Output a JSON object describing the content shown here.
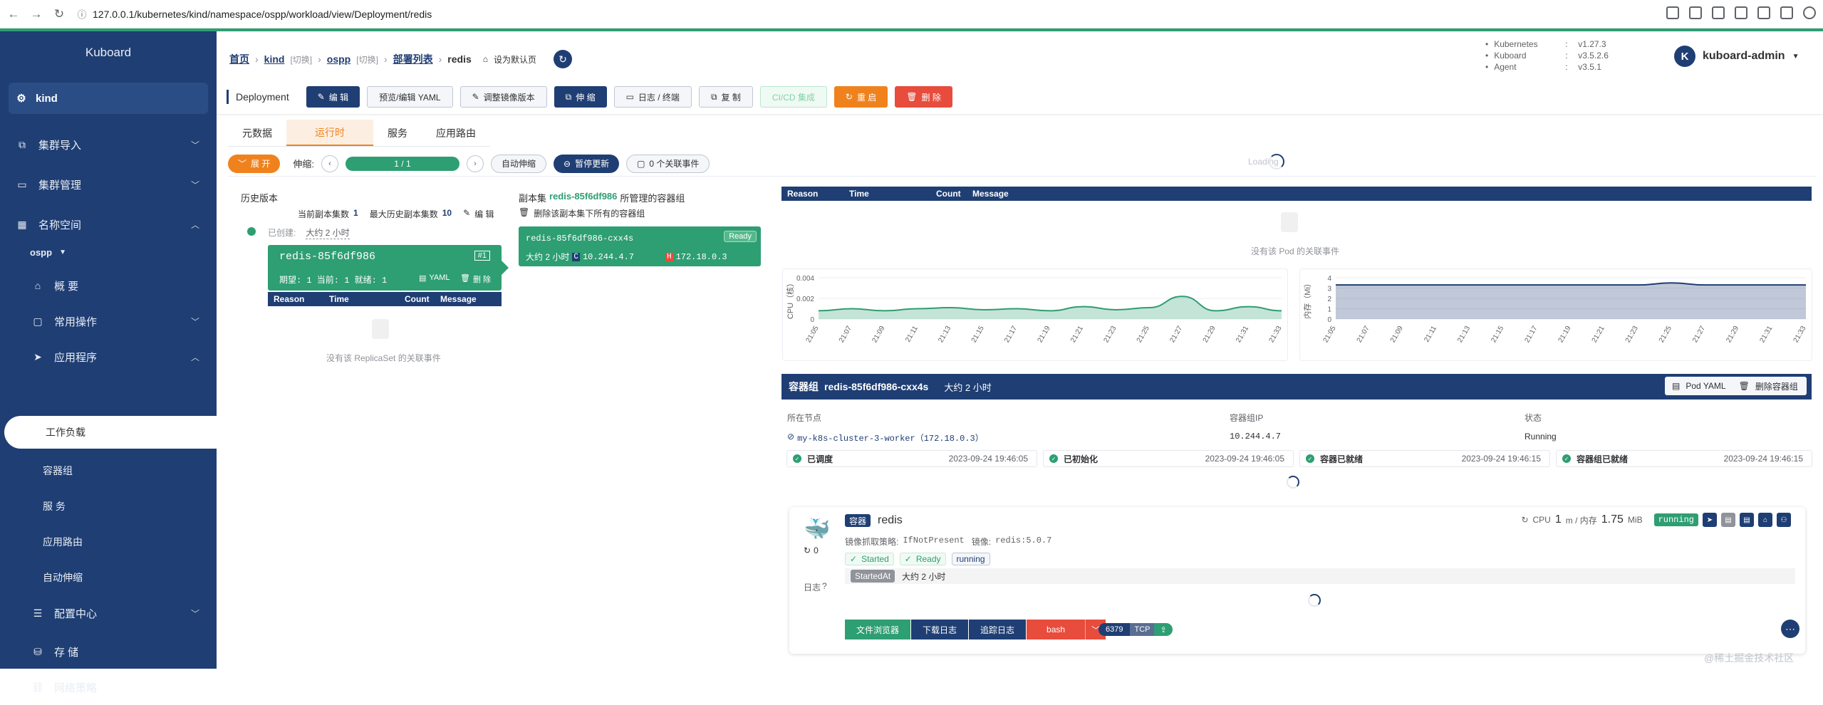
{
  "browser": {
    "url": "127.0.0.1/kubernetes/kind/namespace/ospp/workload/view/Deployment/redis"
  },
  "sidebar": {
    "logo": "Kuboard",
    "cluster": "kind",
    "items": [
      {
        "label": "集群导入"
      },
      {
        "label": "集群管理"
      },
      {
        "label": "名称空间"
      }
    ],
    "namespace": "ospp",
    "ns_items": [
      {
        "label": "概 要"
      },
      {
        "label": "常用操作"
      },
      {
        "label": "应用程序"
      }
    ],
    "app_sub": [
      {
        "label": "工作负载"
      },
      {
        "label": "容器组"
      },
      {
        "label": "服 务"
      },
      {
        "label": "应用路由"
      },
      {
        "label": "自动伸缩"
      }
    ],
    "bottom_items": [
      {
        "label": "配置中心"
      },
      {
        "label": "存 储"
      },
      {
        "label": "网络策略"
      }
    ]
  },
  "breadcrumb": {
    "home": "首页",
    "cluster": "kind",
    "switch1": "[切换]",
    "namespace": "ospp",
    "switch2": "[切换]",
    "list": "部署列表",
    "current": "redis",
    "set_default": "设为默认页"
  },
  "versions": [
    {
      "key": "Kubernetes",
      "value": "v1.27.3"
    },
    {
      "key": "Kuboard",
      "value": "v3.5.2.6"
    },
    {
      "key": "Agent",
      "value": "v3.5.1"
    }
  ],
  "user": {
    "initial": "K",
    "name": "kuboard-admin"
  },
  "toolbar": {
    "label": "Deployment",
    "edit": "编 辑",
    "preview_yaml": "预览/编辑 YAML",
    "adjust_image": "调整镜像版本",
    "scale": "伸 缩",
    "logs": "日志 / 终端",
    "copy": "复 制",
    "cicd": "CI/CD 集成",
    "restart": "重 启",
    "delete": "删 除"
  },
  "tabs": [
    "元数据",
    "运行时",
    "服务",
    "应用路由"
  ],
  "active_tab": "运行时",
  "controls": {
    "expand": "展 开",
    "scale_label": "伸缩:",
    "replicas": "1 / 1",
    "autoscale": "自动伸缩",
    "pause": "暂停更新",
    "events": "0 个关联事件",
    "loading": "Loading"
  },
  "history": {
    "title": "历史版本",
    "current_count_label": "当前副本集数",
    "current_count": "1",
    "max_count_label": "最大历史副本集数",
    "max_count": "10",
    "edit": "编 辑",
    "created_label": "已创建:",
    "created_value": "大约 2 小时",
    "rs_name": "redis-85f6df986",
    "rs_badge": "#1",
    "rs_stats": "期望: 1 当前: 1 就绪: 1",
    "yaml": "YAML",
    "delete": "删 除",
    "empty": "没有该 ReplicaSet 的关联事件"
  },
  "event_cols": [
    "Reason",
    "Time",
    "Count",
    "Message"
  ],
  "replicaset": {
    "title_prefix": "副本集",
    "name": "redis-85f6df986",
    "title_suffix": "所管理的容器组",
    "delete_all": "删除该副本集下所有的容器组",
    "pod_name": "redis-85f6df986-cxx4s",
    "ready": "Ready",
    "age": "大约 2 小时",
    "c_label": "C",
    "pod_ip": "10.244.4.7",
    "h_label": "H",
    "host_ip": "172.18.0.3"
  },
  "pod_events_empty": "没有该 Pod 的关联事件",
  "cpu_chart": {
    "ylabel": "CPU（核）",
    "yticks": [
      "0.004",
      "0.002",
      "0"
    ],
    "xticks": [
      "21:05",
      "21:07",
      "21:09",
      "21:11",
      "21:13",
      "21:15",
      "21:17",
      "21:19",
      "21:21",
      "21:23",
      "21:25",
      "21:27",
      "21:29",
      "21:31",
      "21:33"
    ]
  },
  "mem_chart": {
    "ylabel": "内存（Mi）",
    "yticks": [
      "4",
      "3",
      "2",
      "1",
      "0"
    ],
    "xticks": [
      "21:05",
      "21:07",
      "21:09",
      "21:11",
      "21:13",
      "21:15",
      "21:17",
      "21:19",
      "21:21",
      "21:23",
      "21:25",
      "21:27",
      "21:29",
      "21:31",
      "21:33"
    ]
  },
  "chart_data": [
    {
      "type": "area",
      "ylabel": "CPU（核）",
      "ylim": [
        0,
        0.004
      ],
      "x": [
        "21:05",
        "21:07",
        "21:09",
        "21:11",
        "21:13",
        "21:15",
        "21:17",
        "21:19",
        "21:21",
        "21:23",
        "21:25",
        "21:27",
        "21:29",
        "21:31",
        "21:33"
      ],
      "values": [
        0.0008,
        0.001,
        0.0008,
        0.001,
        0.0011,
        0.0009,
        0.001,
        0.0008,
        0.0012,
        0.0009,
        0.0011,
        0.0022,
        0.0008,
        0.0012,
        0.0008
      ],
      "color": "#2e9e73"
    },
    {
      "type": "area",
      "ylabel": "内存（Mi）",
      "ylim": [
        0,
        4
      ],
      "x": [
        "21:05",
        "21:07",
        "21:09",
        "21:11",
        "21:13",
        "21:15",
        "21:17",
        "21:19",
        "21:21",
        "21:23",
        "21:25",
        "21:27",
        "21:29",
        "21:31",
        "21:33"
      ],
      "values": [
        3.3,
        3.3,
        3.3,
        3.3,
        3.3,
        3.3,
        3.3,
        3.3,
        3.3,
        3.3,
        3.5,
        3.3,
        3.3,
        3.3,
        3.3
      ],
      "color": "#1f3e73"
    }
  ],
  "pod": {
    "head_label": "容器组",
    "name": "redis-85f6df986-cxx4s",
    "age": "大约 2 小时",
    "pod_yaml": "Pod YAML",
    "delete_pod": "删除容器组",
    "node_label": "所在节点",
    "ip_label": "容器组IP",
    "status_label": "状态",
    "node": "my-k8s-cluster-3-worker（172.18.0.3）",
    "ip": "10.244.4.7",
    "status": "Running",
    "conditions": [
      {
        "label": "已调度",
        "time": "2023-09-24 19:46:05"
      },
      {
        "label": "已初始化",
        "time": "2023-09-24 19:46:05"
      },
      {
        "label": "容器已就绪",
        "time": "2023-09-24 19:46:15"
      },
      {
        "label": "容器组已就绪",
        "time": "2023-09-24 19:46:15"
      }
    ]
  },
  "container": {
    "tag": "容器",
    "name": "redis",
    "restarts": "0",
    "pull_policy_label": "镜像抓取策略:",
    "pull_policy": "IfNotPresent",
    "image_label": "镜像:",
    "image": "redis:5.0.7",
    "started": "Started",
    "ready": "Ready",
    "running": "running",
    "started_at": "StartedAt",
    "started_at_val": "大约 2 小时",
    "logs_label": "日志",
    "cpu_label": "CPU",
    "cpu_val": "1",
    "cpu_unit": "m / 内存",
    "mem_val": "1.75",
    "mem_unit": "MiB",
    "status": "running",
    "file_browser": "文件浏览器",
    "download_log": "下载日志",
    "tail_log": "追踪日志",
    "shell": "bash",
    "port": "6379",
    "proto": "TCP"
  },
  "watermark": "@稀土掘金技术社区"
}
